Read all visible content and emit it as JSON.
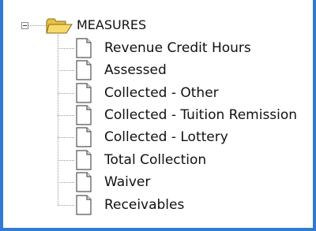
{
  "tree": {
    "root": {
      "label": "MEASURES",
      "icon": "folder-icon",
      "expander_icon": "collapse-minus-icon"
    },
    "items": [
      {
        "label": "Revenue Credit Hours",
        "icon": "document-icon"
      },
      {
        "label": "Assessed",
        "icon": "document-icon"
      },
      {
        "label": "Collected - Other",
        "icon": "document-icon"
      },
      {
        "label": "Collected - Tuition Remission",
        "icon": "document-icon"
      },
      {
        "label": "Collected - Lottery",
        "icon": "document-icon"
      },
      {
        "label": "Total Collection",
        "icon": "document-icon"
      },
      {
        "label": "Waiver",
        "icon": "document-icon"
      },
      {
        "label": "Receivables",
        "icon": "document-icon"
      }
    ]
  },
  "colors": {
    "frame_border": "#2f7bd3",
    "folder_fill": "#f4d257",
    "folder_stroke": "#8a6a12",
    "text": "#111111"
  }
}
